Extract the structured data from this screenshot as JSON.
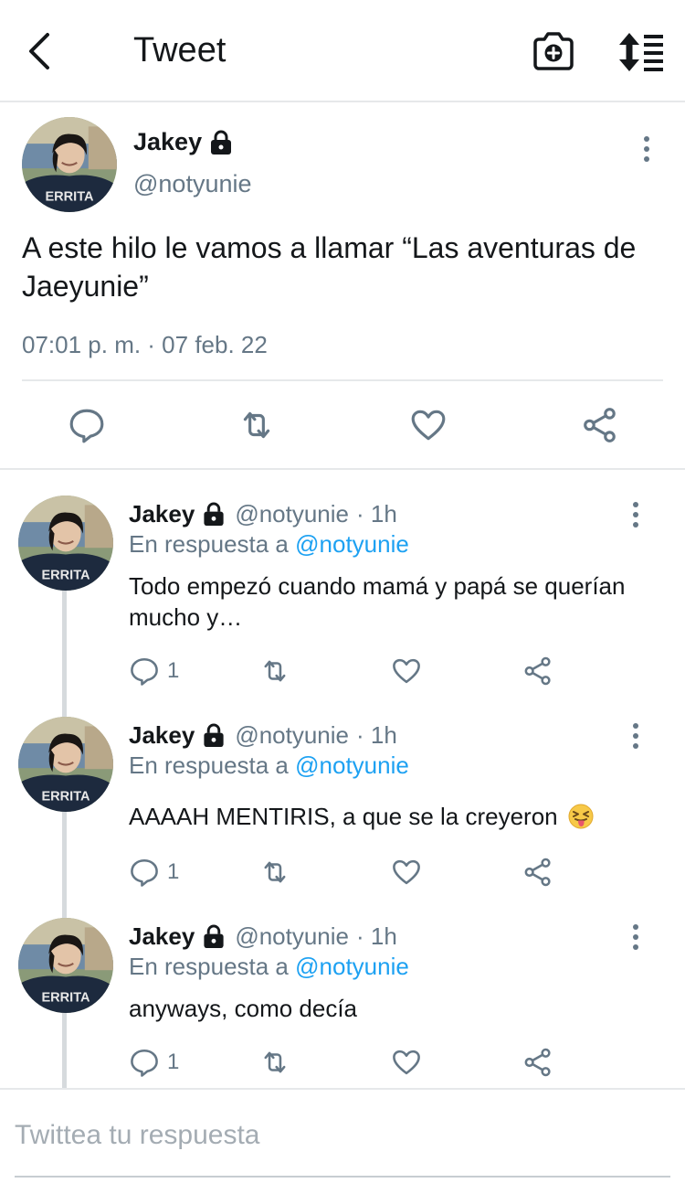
{
  "header": {
    "title": "Tweet",
    "back_icon": "chevron-left-icon",
    "camera_icon": "camera-plus-icon",
    "sort_icon": "sort-list-icon"
  },
  "main_tweet": {
    "name": "Jakey",
    "handle": "@notyunie",
    "text": "A este hilo le vamos a llamar “Las aventuras de Jaeyunie”",
    "timestamp": "07:01 p. m. · 07 feb. 22"
  },
  "replies": [
    {
      "name": "Jakey",
      "handle": "@notyunie",
      "time": "· 1h",
      "reply_prefix": "En respuesta a ",
      "reply_to": "@notyunie",
      "text": "Todo empezó cuando mamá y papá se querían mucho y…",
      "reply_count": "1"
    },
    {
      "name": "Jakey",
      "handle": "@notyunie",
      "time": "· 1h",
      "reply_prefix": "En respuesta a ",
      "reply_to": "@notyunie",
      "text": "AAAAH MENTIRIS, a que se la creyeron",
      "emoji": "tongue-squint-emoji",
      "reply_count": "1"
    },
    {
      "name": "Jakey",
      "handle": "@notyunie",
      "time": "· 1h",
      "reply_prefix": "En respuesta a ",
      "reply_to": "@notyunie",
      "text": "anyways, como decía",
      "reply_count": "1"
    }
  ],
  "compose": {
    "placeholder": "Twittea tu respuesta"
  },
  "colors": {
    "text": "#14171a",
    "secondary": "#657786",
    "link": "#1da1f2",
    "divider": "#e6e8ea"
  }
}
